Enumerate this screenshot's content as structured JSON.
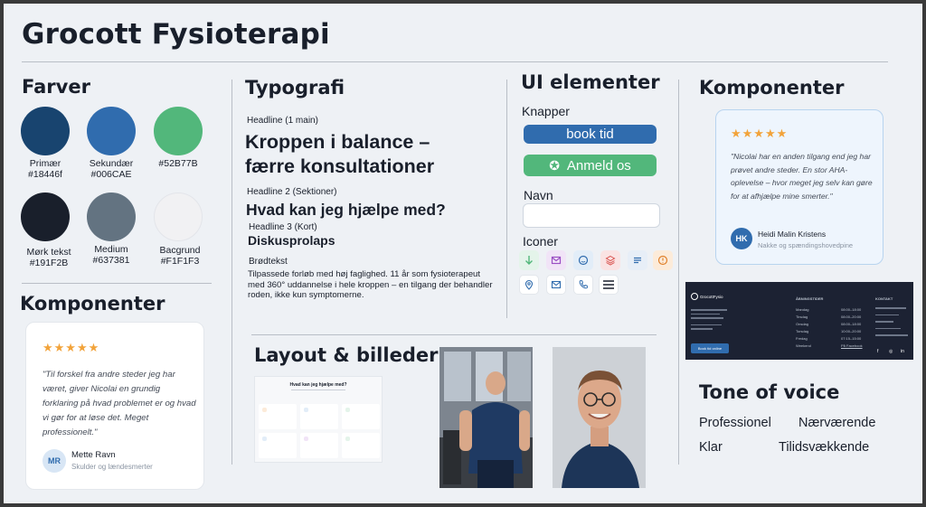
{
  "title": "Grocott Fysioterapi",
  "colors": {
    "heading": "Farver",
    "swatches": [
      {
        "name": "Primær",
        "hex": "#18446f",
        "label": "#18446f"
      },
      {
        "name": "Sekundær",
        "hex": "#306CAE",
        "label": "#006CAE"
      },
      {
        "name": "",
        "hex": "#52B77B",
        "label": "#52B77B"
      },
      {
        "name": "Mørk tekst",
        "hex": "#191F2B",
        "label": "#191F2B"
      },
      {
        "name": "Medium",
        "hex": "#637381",
        "label": "#637381"
      },
      {
        "name": "Bacgrund",
        "hex": "#F1F1F3",
        "label": "#F1F1F3"
      }
    ]
  },
  "typography": {
    "heading": "Typografi",
    "h1_label": "Headline (1 main)",
    "h1_line1": "Kroppen i balance –",
    "h1_line2": "færre konsultationer",
    "h2_label": "Headline 2 (Sektioner)",
    "h2_text": "Hvad kan jeg hjælpe med?",
    "h3_label": "Headline 3 (Kort)",
    "h3_text": "Diskusprolaps",
    "body_label": "Brødtekst",
    "body_text": "Tilpassede forløb med høj faglighed. 11 år som fysioterapeut med 360° uddannelse i hele kroppen – en tilgang der behandler roden, ikke kun symptomerne."
  },
  "ui": {
    "heading": "UI elementer",
    "buttons_label": "Knapper",
    "book_button": "book tid",
    "review_button": "Anmeld os",
    "name_label": "Navn",
    "name_value": "",
    "icons_label": "Iconer",
    "icons": [
      "arrow-down-icon",
      "envelope-open-icon",
      "smile-icon",
      "layers-icon",
      "text-lines-icon",
      "alert-circle-icon",
      "map-pin-icon",
      "mail-icon",
      "phone-icon",
      "menu-icon"
    ]
  },
  "components_right": {
    "heading": "Komponenter",
    "stars": "★★★★★",
    "quote": "\"Nicolai har en anden tilgang end jeg har prøvet andre steder. En stor AHA-oplevelse – hvor meget jeg selv kan gøre for at afhjælpe mine smerter.\"",
    "initials": "HK",
    "name": "Heidi Malin Kristens",
    "subtitle": "Nakke og spændingshovedpine"
  },
  "components_left": {
    "heading": "Komponenter",
    "stars": "★★★★★",
    "quote": "\"Til forskel fra andre steder jeg har været, giver Nicolai en grundig forklaring på hvad problemet er og hvad vi gør for at løse det. Meget professionelt.\"",
    "initials": "MR",
    "name": "Mette Ravn",
    "subtitle": "Skulder og lændesmerter"
  },
  "layout": {
    "heading": "Layout & billeder",
    "mini_title": "Hvad kan jeg hjælpe med?"
  },
  "footer": {
    "brand": "GrocottFysio",
    "book_label": "Book tid online",
    "hours_heading": "ÅBNINGSTIDER",
    "contact_heading": "KONTAKT",
    "days": [
      "Mandag",
      "Tirsdag",
      "Onsdag",
      "Torsdag",
      "Fredag",
      "Weekend"
    ],
    "hours": [
      "08:00–18:00",
      "08:00–20:00",
      "08:00–18:00",
      "10:00–20:00",
      "07:15–15:00",
      "På Facebook"
    ]
  },
  "tone": {
    "heading": "Tone of voice",
    "words": [
      "Professionel",
      "Nærværende",
      "Klar",
      "Tilidsvækkende"
    ]
  }
}
